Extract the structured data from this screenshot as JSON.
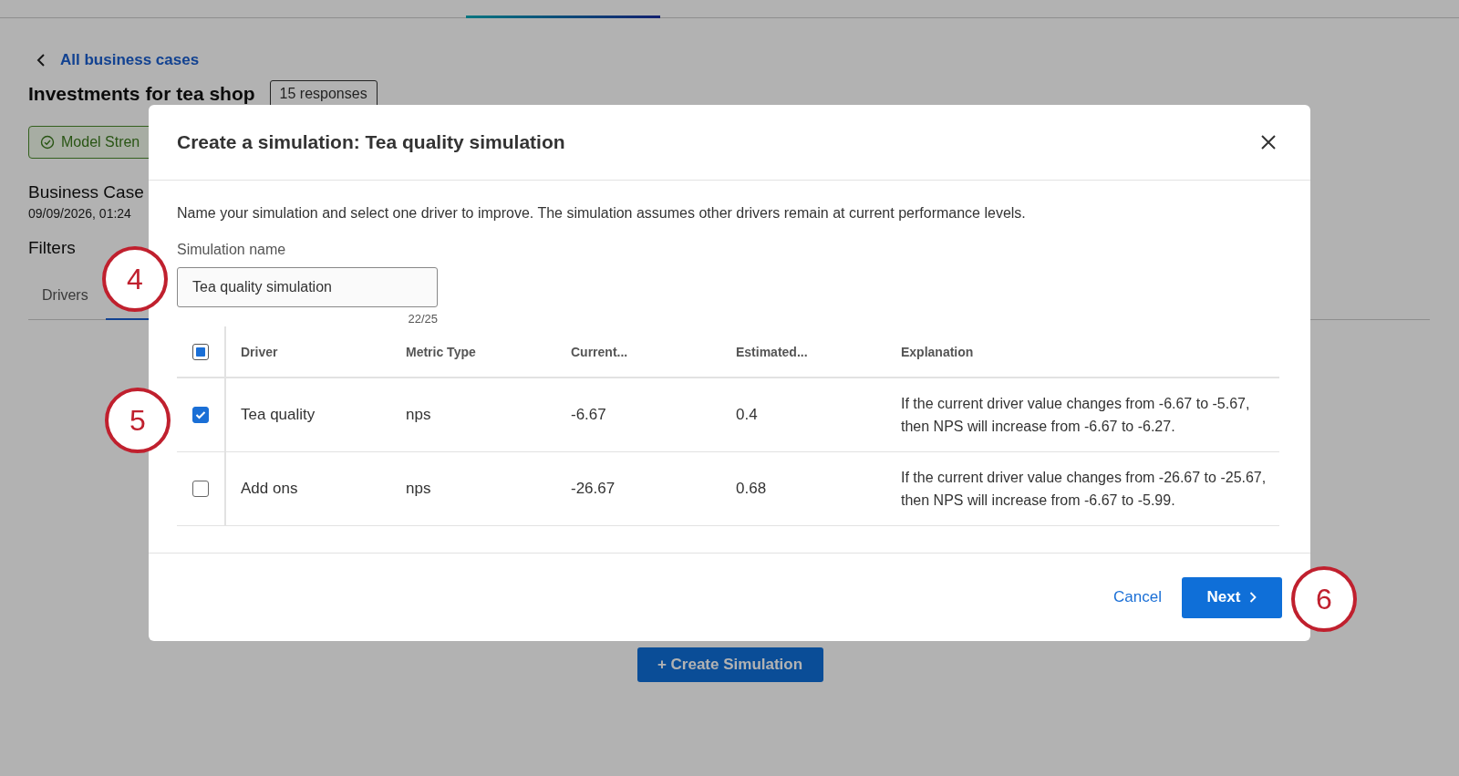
{
  "page": {
    "back_link": "All business cases",
    "title": "Investments for tea shop",
    "responses_badge": "15 responses",
    "model_badge": "Model Stren",
    "section_title": "Business Case",
    "timestamp": "09/09/2026, 01:24",
    "filters_label": "Filters",
    "tabs": [
      {
        "label": "Drivers",
        "selected": false
      }
    ],
    "create_button": "+ Create Simulation"
  },
  "dialog": {
    "title": "Create a simulation: Tea quality simulation",
    "description": "Name your simulation and select one driver to improve. The simulation assumes other drivers remain at current performance levels.",
    "name_field": {
      "label": "Simulation name",
      "value": "Tea quality simulation",
      "counter": "22/25"
    },
    "table": {
      "select_all": {
        "indeterminate": true
      },
      "columns": [
        "Driver",
        "Metric Type",
        "Current...",
        "Estimated...",
        "Explanation"
      ],
      "rows": [
        {
          "checked": true,
          "cells": [
            "Tea quality",
            "nps",
            "-6.67",
            "0.4",
            "If the current driver value changes from -6.67 to -5.67, then NPS will increase from -6.67 to -6.27."
          ]
        },
        {
          "checked": false,
          "cells": [
            "Add ons",
            "nps",
            "-26.67",
            "0.68",
            "If the current driver value changes from -26.67 to -25.67, then NPS will increase from -6.67 to -5.99."
          ]
        }
      ]
    },
    "buttons": [
      {
        "kind": "link",
        "label": "Cancel"
      },
      {
        "kind": "primary",
        "label": "Next"
      }
    ]
  },
  "callouts": [
    {
      "label": "4"
    },
    {
      "label": "5"
    },
    {
      "label": "6"
    }
  ]
}
